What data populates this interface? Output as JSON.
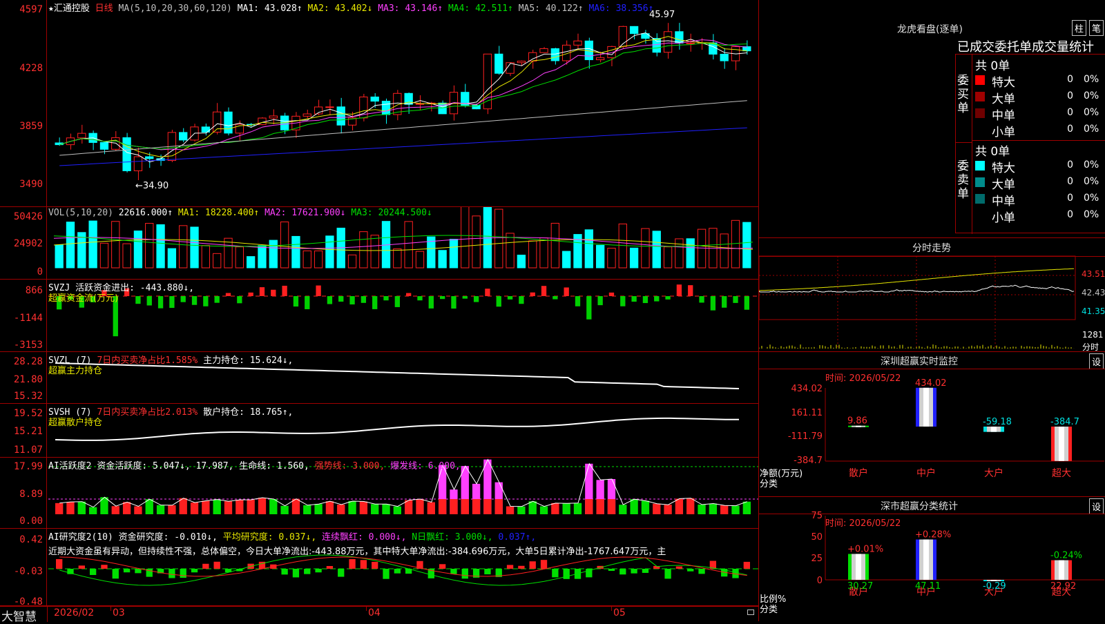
{
  "app": {
    "brand": "大智慧"
  },
  "main_chart": {
    "stock": "★汇通控股",
    "period": "日线",
    "ma_params": "MA(5,10,20,30,60,120)",
    "ma": [
      {
        "label": "MA1: 43.028↑",
        "color": "#ffffff"
      },
      {
        "label": "MA2: 43.402↓",
        "color": "#e8e800"
      },
      {
        "label": "MA3: 43.146↑",
        "color": "#ff40ff"
      },
      {
        "label": "MA4: 42.511↑",
        "color": "#00e000"
      },
      {
        "label": "MA5: 40.122↑",
        "color": "#c0c0c0"
      },
      {
        "label": "MA6: 38.356↑",
        "color": "#2020ff"
      }
    ],
    "y_ticks": [
      "4597",
      "4228",
      "3859",
      "3490"
    ],
    "high_label": "45.97",
    "low_label": "←34.90"
  },
  "vol": {
    "header": "VOL(5,10,20)",
    "value": "22616.000↑",
    "ma1": "MA1: 18228.400↑",
    "ma2": "MA2: 17621.900↓",
    "ma3": "MA3: 20244.500↓",
    "y_ticks": [
      "50426",
      "24902",
      "0"
    ]
  },
  "svzj": {
    "header": "SVZJ  活跃资金进出: -443.880↓,",
    "sub": "超赢资金流(万元)",
    "y_ticks": [
      "866",
      "-1144",
      "-3153"
    ]
  },
  "svzl": {
    "name": "SVZL (7)",
    "ratio": "7日内买卖净占比1.585%",
    "hold": "主力持仓: 15.624↓,",
    "sub": "超赢主力持仓",
    "y_ticks": [
      "28.28",
      "21.80",
      "15.32"
    ]
  },
  "svsh": {
    "name": "SVSH (7)",
    "ratio": "7日内买卖净占比2.013%",
    "hold": "散户持仓: 18.765↑,",
    "sub": "超赢散户持仓",
    "y_ticks": [
      "19.52",
      "15.21",
      "11.07"
    ]
  },
  "ai1": {
    "name": "AI活跃度2",
    "a": "资金活跃度: 5.047↓,",
    "b": "17.987,",
    "c": "生命线: 1.560,",
    "d": "强势线: 3.000,",
    "e": "爆发线: 6.000,",
    "y_ticks": [
      "17.99",
      "8.89",
      "0.00"
    ]
  },
  "ai2": {
    "name": "AI研究度2(10)",
    "a": "资金研究度: -0.010↓,",
    "b": "平均研究度: 0.037↓,",
    "c": "连续飘红: 0.000↓,",
    "d": "N日飘红: 3.000↓,",
    "e": "0.037↑,",
    "comment": "近期大资金虽有异动，但持续性不强，总体偏空，今日大单净流出:-443.88万元，其中特大单净流出:-384.696万元，大单5日累计净出-1767.647万元，主",
    "y_ticks": [
      "0.42",
      "-0.03",
      "-0.48"
    ]
  },
  "x_axis": [
    "2026/02",
    "03",
    "04",
    "05"
  ],
  "longhu": {
    "title": "龙虎看盘(逐单)",
    "btn1": "柱",
    "btn2": "笔",
    "tabs": "已成交委托单成交量统计",
    "buy_label": "委买单",
    "sell_label": "委卖单",
    "buy_total": "共 0单",
    "sell_total": "共 0单",
    "rows": [
      {
        "name": "特大",
        "count": "0",
        "pct": "0%"
      },
      {
        "name": "大单",
        "count": "0",
        "pct": "0%"
      },
      {
        "name": "中单",
        "count": "0",
        "pct": "0%"
      },
      {
        "name": "小单",
        "count": "0",
        "pct": "0%"
      }
    ],
    "colors": {
      "buy": [
        "#ff0000",
        "#a00000",
        "#700000"
      ],
      "sell": [
        "#00ffff",
        "#008c8c",
        "#006b6b"
      ]
    }
  },
  "fenshi": {
    "title": "分时走势",
    "prices": [
      "43.51",
      "42.43",
      "41.35"
    ],
    "vol_tick": "1281",
    "label": "分时"
  },
  "monitor": {
    "title": "深圳超赢实时监控",
    "btn": "设",
    "time": "时间: 2026/05/22",
    "y_ticks": [
      "434.02",
      "161.11",
      "-111.79",
      "-384.7"
    ],
    "ylabel": "净额(万元)",
    "xlabel": "分类",
    "cats": [
      "散户",
      "中户",
      "大户",
      "超大"
    ],
    "values": [
      9.86,
      434.02,
      -59.18,
      -384.7
    ],
    "labels": [
      "9.86",
      "434.02",
      "-59.18",
      "-384.7"
    ]
  },
  "classify": {
    "title": "深市超赢分类统计",
    "btn": "设",
    "time": "时间: 2026/05/22",
    "y_ticks": [
      "75",
      "50",
      "25",
      "0"
    ],
    "ylabel": "比例%",
    "xlabel": "分类",
    "cats": [
      "散户",
      "中户",
      "大户",
      "超大"
    ],
    "values": [
      30.27,
      47.11,
      -0.29,
      22.92
    ],
    "bottom_labels": [
      "30.27",
      "47.11",
      "-0.29",
      "22.92"
    ],
    "top_labels": [
      "+0.01%",
      "+0.28%",
      "",
      "-0.24%"
    ]
  }
}
